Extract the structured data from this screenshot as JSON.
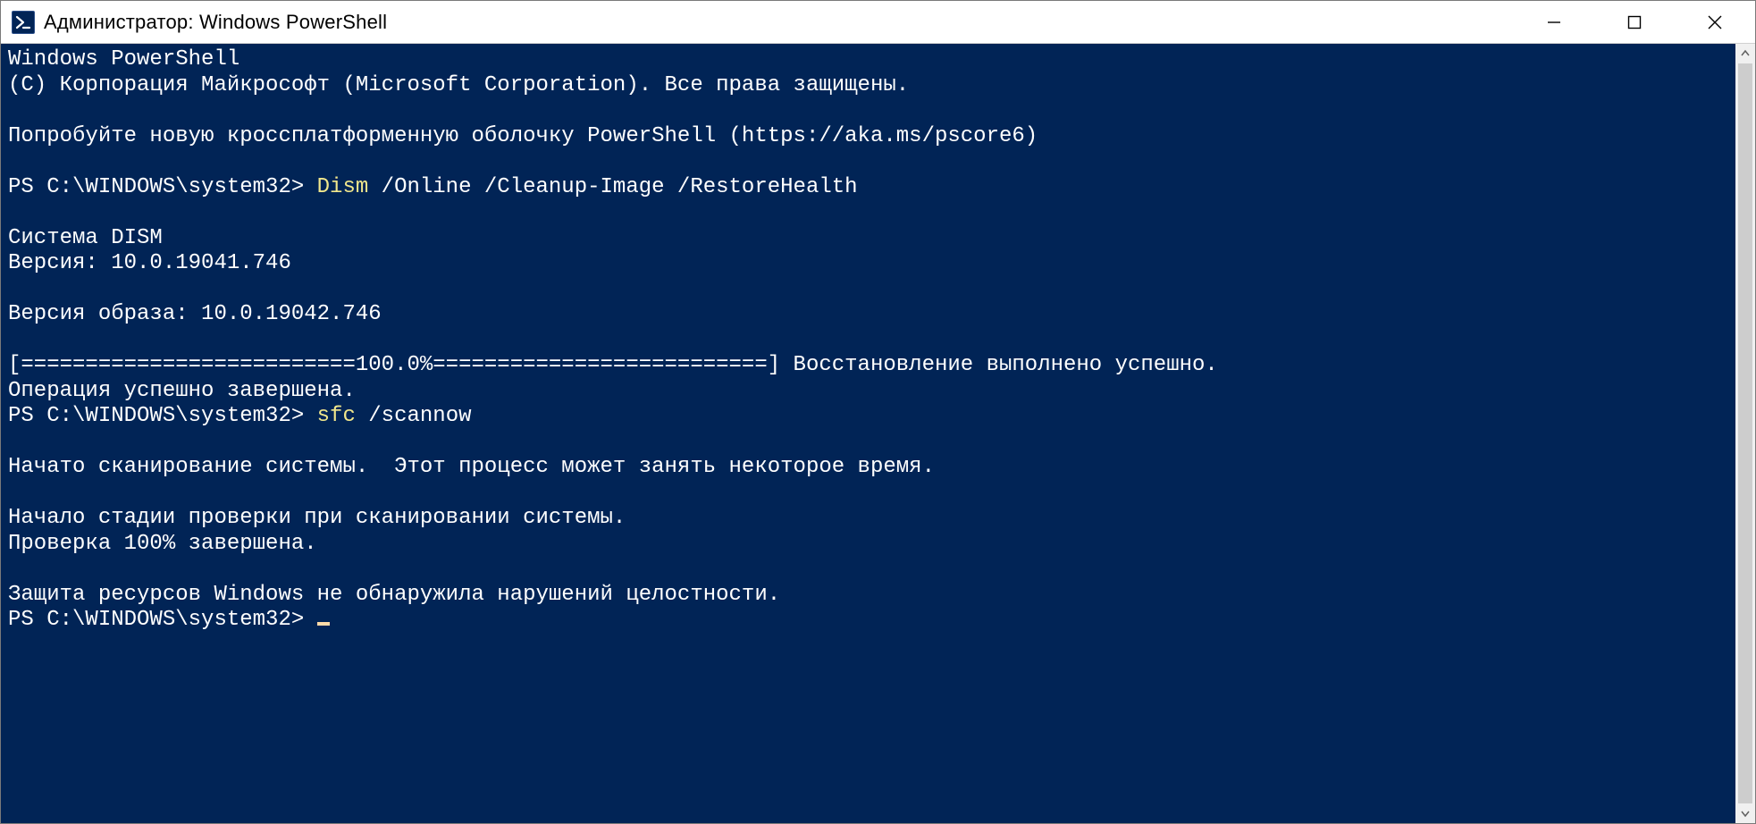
{
  "window": {
    "title": "Администратор: Windows PowerShell"
  },
  "terminal": {
    "header_line1": "Windows PowerShell",
    "header_line2": "(C) Корпорация Майкрософт (Microsoft Corporation). Все права защищены.",
    "promo_line": "Попробуйте новую кроссплатформенную оболочку PowerShell (https://aka.ms/pscore6)",
    "prompt1_prefix": "PS C:\\WINDOWS\\system32> ",
    "prompt1_cmd": "Dism",
    "prompt1_args": " /Online /Cleanup-Image /RestoreHealth",
    "dism_system": "Cистема DISM",
    "dism_version": "Версия: 10.0.19041.746",
    "image_version": "Версия образа: 10.0.19042.746",
    "progress_line": "[==========================100.0%==========================] Восстановление выполнено успешно.",
    "operation_done": "Операция успешно завершена.",
    "prompt2_prefix": "PS C:\\WINDOWS\\system32> ",
    "prompt2_cmd": "sfc",
    "prompt2_args": " /scannow",
    "scan_started": "Начато сканирование системы.  Этот процесс может занять некоторое время.",
    "scan_stage": "Начало стадии проверки при сканировании системы.",
    "scan_progress": "Проверка 100% завершена.",
    "scan_result": "Защита ресурсов Windows не обнаружила нарушений целостности.",
    "prompt3_prefix": "PS C:\\WINDOWS\\system32> "
  }
}
